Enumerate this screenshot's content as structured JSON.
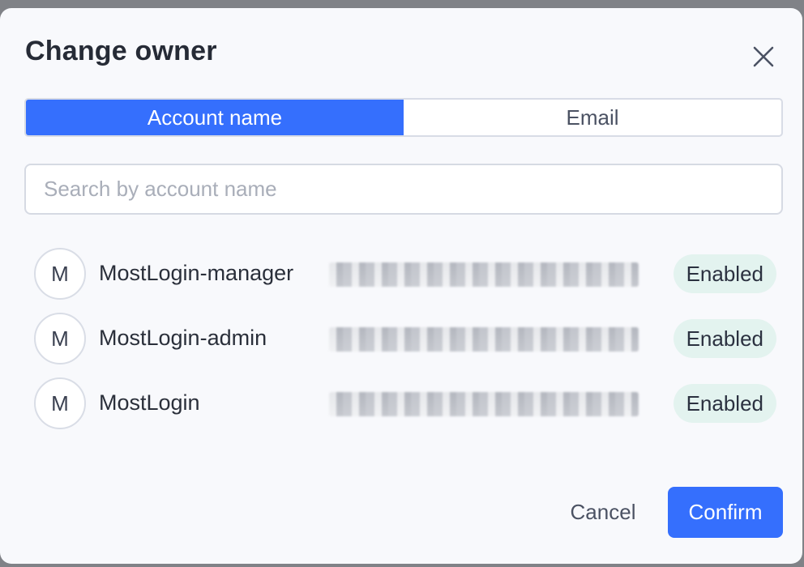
{
  "dialog": {
    "title": "Change owner",
    "close_icon": "close-icon"
  },
  "tabs": [
    {
      "label": "Account name",
      "active": true
    },
    {
      "label": "Email",
      "active": false
    }
  ],
  "search": {
    "placeholder": "Search by account name",
    "value": ""
  },
  "accounts": [
    {
      "initial": "M",
      "name": "MostLogin-manager",
      "status": "Enabled"
    },
    {
      "initial": "M",
      "name": "MostLogin-admin",
      "status": "Enabled"
    },
    {
      "initial": "M",
      "name": "MostLogin",
      "status": "Enabled"
    }
  ],
  "footer": {
    "cancel_label": "Cancel",
    "confirm_label": "Confirm"
  },
  "colors": {
    "primary": "#356ffd",
    "badge_bg": "#e3f3ef",
    "title": "#262b36"
  }
}
